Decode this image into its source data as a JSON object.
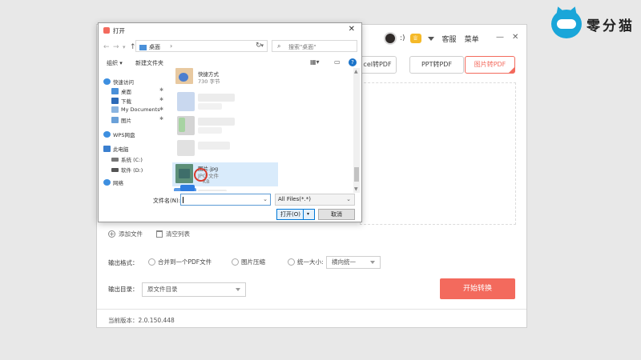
{
  "brand": {
    "name": "零分猫"
  },
  "app": {
    "header": {
      "user_status": ":)",
      "vip_badge": "♕",
      "links": [
        "客服",
        "菜单"
      ],
      "window_controls": {
        "minimize": "—",
        "close": "✕"
      }
    },
    "tabs": [
      {
        "label": "Excel转PDF",
        "visible_label": "cel转PDF"
      },
      {
        "label": "PPT转PDF"
      },
      {
        "label": "图片转PDF",
        "active": true
      }
    ],
    "actions": {
      "add_file": "添加文件",
      "clear_list": "清空列表"
    },
    "output_format": {
      "label": "输出格式：",
      "options": [
        "合并到一个PDF文件",
        "图片压缩",
        "统一大小:"
      ],
      "size_select": "横向统一"
    },
    "output_dir": {
      "label": "输出目录：",
      "value": "原文件目录"
    },
    "start_button": "开始转换",
    "version": "当前版本：2.0.150.448"
  },
  "dialog": {
    "title": "打开",
    "close": "✕",
    "address": {
      "path": "桌面",
      "chevron": "›"
    },
    "search_placeholder": "搜索\"桌面\"",
    "toolbar": {
      "organize": "组织 ▾",
      "new_folder": "新建文件夹"
    },
    "nav": [
      {
        "label": "快速访问",
        "icon": "star-icon"
      },
      {
        "label": "桌面",
        "icon": "desktop-folder-icon",
        "pinned": true
      },
      {
        "label": "下载",
        "icon": "download-icon",
        "pinned": true
      },
      {
        "label": "My Documents",
        "icon": "documents-icon",
        "pinned": true
      },
      {
        "label": "图片",
        "icon": "pictures-icon",
        "pinned": true
      },
      {
        "label": "WPS网盘",
        "icon": "cloud-icon"
      },
      {
        "label": "此电脑",
        "icon": "computer-icon"
      },
      {
        "label": "系统 (C:)",
        "icon": "drive-icon"
      },
      {
        "label": "软件 (D:)",
        "icon": "drive-icon"
      },
      {
        "label": "网络",
        "icon": "network-icon"
      }
    ],
    "files": [
      {
        "name": "快捷方式",
        "meta": "730 字节"
      },
      {
        "name": "图片.jpg",
        "meta": "JPG 文件",
        "size": "KB",
        "selected": true
      }
    ],
    "filename_label": "文件名(N):",
    "filename_value": "",
    "filetype": "All Files(*.*)",
    "open_button": "打开(O)",
    "cancel_button": "取消"
  },
  "colors": {
    "accent": "#f36a5d",
    "brand_blue": "#1aa6d9",
    "selection": "#d9ebfb"
  }
}
